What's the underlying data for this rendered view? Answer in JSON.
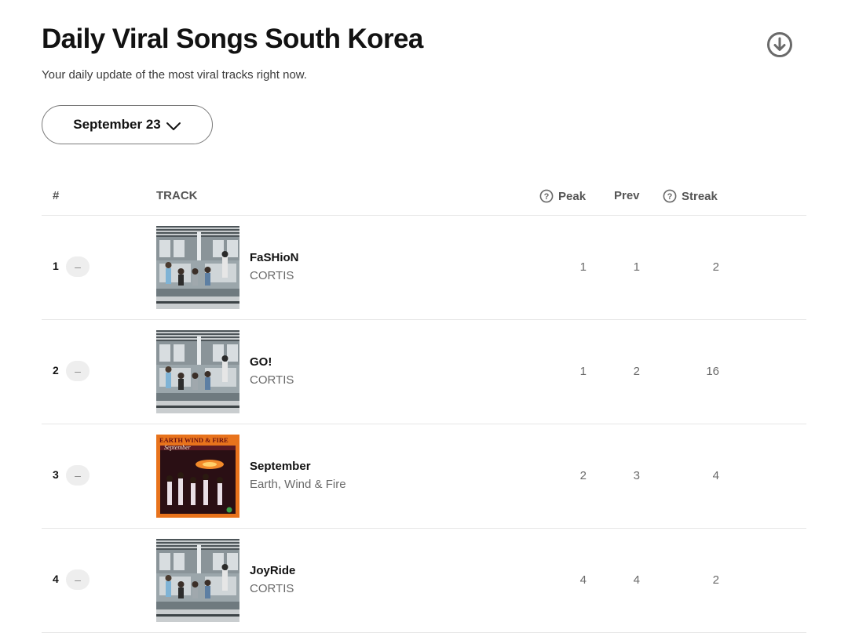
{
  "header": {
    "title": "Daily Viral Songs South Korea",
    "subtitle": "Your daily update of the most viral tracks right now.",
    "date_selector": "September 23",
    "download_icon": "download-circle-icon"
  },
  "table": {
    "columns": {
      "rank": "#",
      "track": "TRACK",
      "peak": "Peak",
      "prev": "Prev",
      "streak": "Streak"
    },
    "rows": [
      {
        "rank": "1",
        "trend": "–",
        "title": "FaSHioN",
        "artist": "CORTIS",
        "peak": "1",
        "prev": "1",
        "streak": "2",
        "art": "cortis"
      },
      {
        "rank": "2",
        "trend": "–",
        "title": "GO!",
        "artist": "CORTIS",
        "peak": "1",
        "prev": "2",
        "streak": "16",
        "art": "cortis"
      },
      {
        "rank": "3",
        "trend": "–",
        "title": "September",
        "artist": "Earth, Wind & Fire",
        "peak": "2",
        "prev": "3",
        "streak": "4",
        "art": "ewf"
      },
      {
        "rank": "4",
        "trend": "–",
        "title": "JoyRide",
        "artist": "CORTIS",
        "peak": "4",
        "prev": "4",
        "streak": "2",
        "art": "cortis"
      }
    ]
  },
  "colors": {
    "text_primary": "#121212",
    "text_secondary": "#6a6a6a",
    "divider": "#e6e6e6",
    "trend_pill": "#eeeeee",
    "ewf_cover_orange": "#e8731c"
  }
}
